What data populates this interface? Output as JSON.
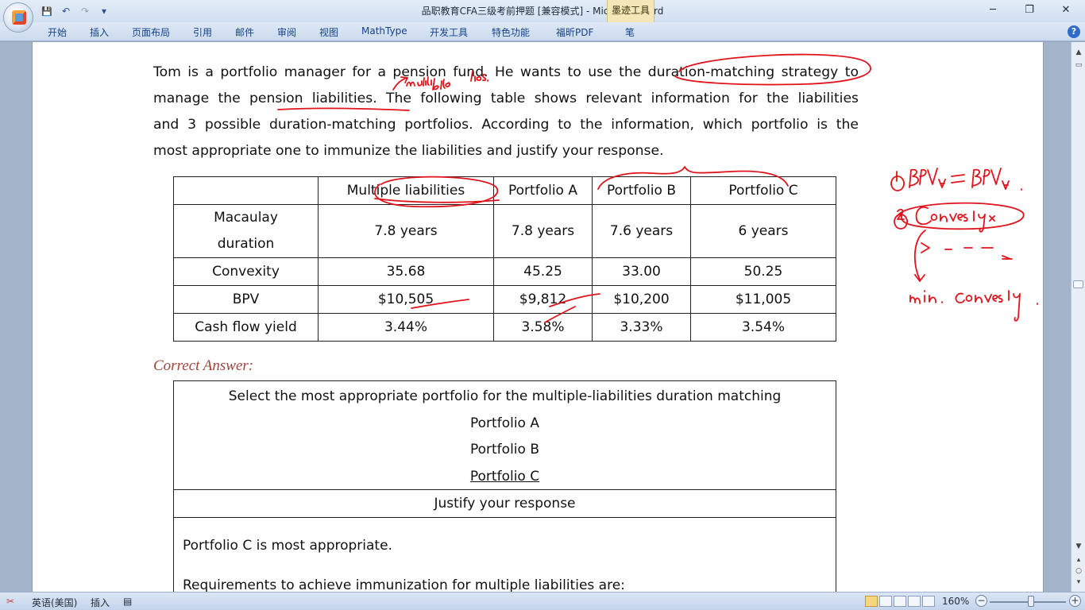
{
  "window": {
    "title": "品职教育CFA三级考前押题 [兼容模式] - Microsoft Word",
    "context_tab": "墨迹工具",
    "minimize": "─",
    "restore": "❐",
    "close": "✕"
  },
  "qat": {
    "save": "💾",
    "undo": "↶",
    "redo": "↷",
    "customize": "▾"
  },
  "ribbon": {
    "tabs": [
      "开始",
      "插入",
      "页面布局",
      "引用",
      "邮件",
      "审阅",
      "视图",
      "MathType",
      "开发工具",
      "特色功能",
      "福昕PDF",
      "笔"
    ],
    "help": "?"
  },
  "document": {
    "question_lines": [
      "Tom is a portfolio manager for a pension fund. He wants to use the duration-matching strategy to",
      "manage the pension liabilities. The following table shows relevant information for the liabilities",
      "and 3 possible duration-matching portfolios. According to the information, which portfolio is the",
      "most appropriate one to immunize the liabilities and justify your response."
    ],
    "table": {
      "headers": [
        "",
        "Multiple liabilities",
        "Portfolio A",
        "Portfolio B",
        "Portfolio C"
      ],
      "rows": [
        {
          "label_l1": "Macaulay",
          "label_l2": "duration",
          "values": [
            "7.8 years",
            "7.8 years",
            "7.6 years",
            "6 years"
          ]
        },
        {
          "label": "Convexity",
          "values": [
            "35.68",
            "45.25",
            "33.00",
            "50.25"
          ]
        },
        {
          "label": "BPV",
          "values": [
            "$10,505",
            "$9,812",
            "$10,200",
            "$11,005"
          ]
        },
        {
          "label": "Cash flow yield",
          "values": [
            "3.44%",
            "3.58%",
            "3.33%",
            "3.54%"
          ]
        }
      ]
    },
    "correct_answer_label": "Correct Answer:",
    "answer": {
      "prompt": "Select the most appropriate portfolio for the multiple-liabilities duration matching",
      "options": [
        "Portfolio A",
        "Portfolio B",
        "Portfolio C"
      ],
      "justify_header": "Justify your response",
      "response_lines": [
        "Portfolio C is most appropriate.",
        "Requirements to achieve immunization for multiple liabilities are:"
      ]
    }
  },
  "statusbar": {
    "language": "英语(美国)",
    "insert_mode": "插入",
    "zoom": "160%",
    "zoom_out": "−",
    "zoom_in": "+"
  },
  "annotations": {
    "note_color": "#e0141c"
  }
}
